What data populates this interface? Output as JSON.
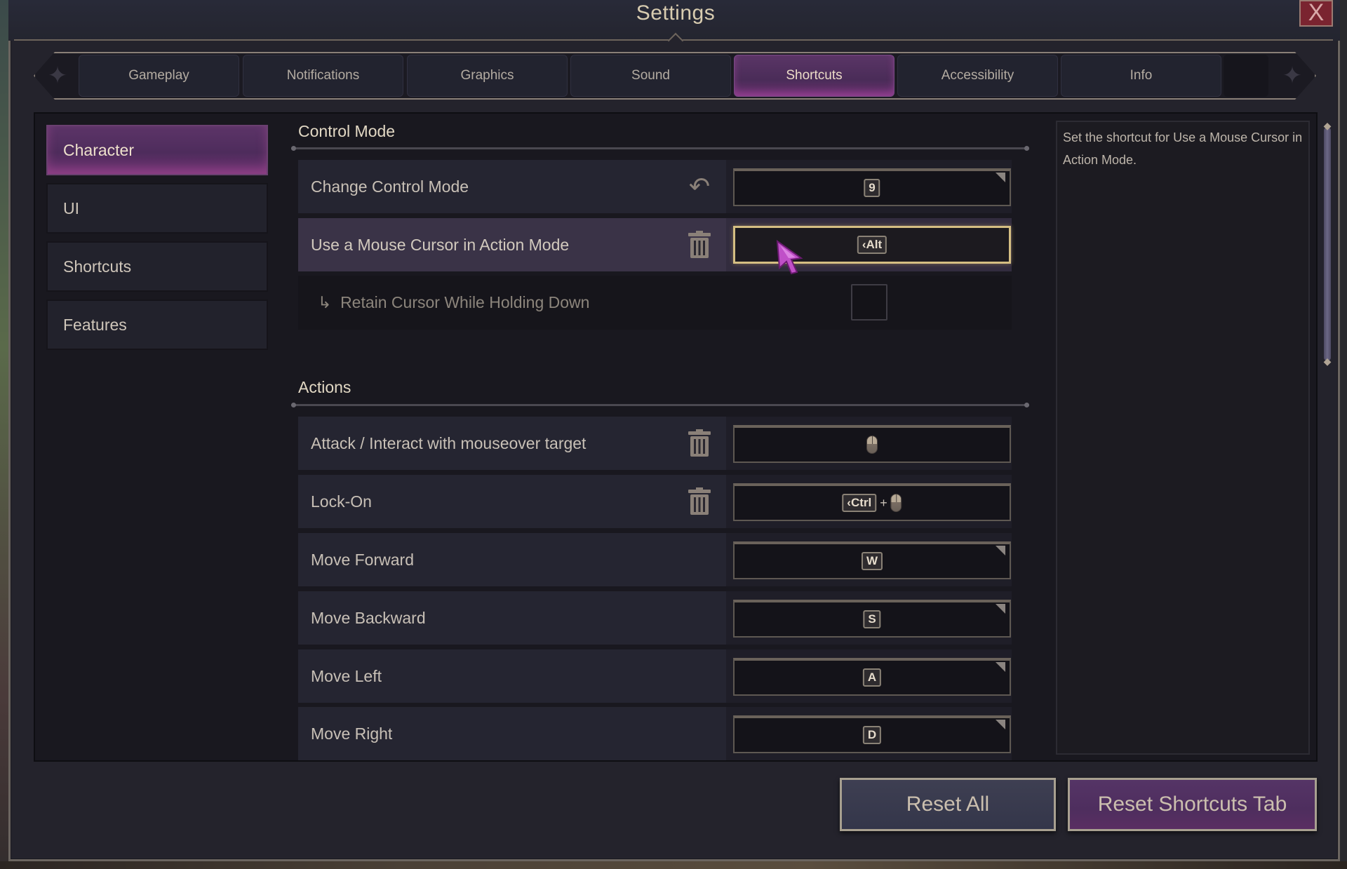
{
  "window": {
    "title": "Settings",
    "close_label": "X"
  },
  "tabs": [
    {
      "label": "Gameplay",
      "active": false
    },
    {
      "label": "Notifications",
      "active": false
    },
    {
      "label": "Graphics",
      "active": false
    },
    {
      "label": "Sound",
      "active": false
    },
    {
      "label": "Shortcuts",
      "active": true
    },
    {
      "label": "Accessibility",
      "active": false
    },
    {
      "label": "Info",
      "active": false
    }
  ],
  "tab_arrows": {
    "prev_icon": "ornate-left-arrow",
    "next_icon": "ornate-right-arrow"
  },
  "sidebar": {
    "items": [
      {
        "label": "Character",
        "active": true
      },
      {
        "label": "UI",
        "active": false
      },
      {
        "label": "Shortcuts",
        "active": false
      },
      {
        "label": "Features",
        "active": false
      }
    ]
  },
  "sections": {
    "control_mode": {
      "title": "Control Mode",
      "rows": [
        {
          "label": "Change Control Mode",
          "action_icon": "undo-icon",
          "binding": "9",
          "has_dropdown": true
        },
        {
          "label": "Use a Mouse Cursor in Action Mode",
          "action_icon": "trash-icon",
          "binding": "Alt",
          "selected": true,
          "focused": true
        }
      ],
      "sub_option": {
        "prefix": "↳",
        "label": "Retain Cursor While Holding Down",
        "checked": false
      }
    },
    "actions": {
      "title": "Actions",
      "rows": [
        {
          "label": "Attack / Interact with mouseover target",
          "action_icon": "trash-icon",
          "binding": "left-mouse-button"
        },
        {
          "label": "Lock-On",
          "action_icon": "trash-icon",
          "binding_modifier": "Ctrl",
          "binding_plus": "+",
          "binding": "left-mouse-button"
        },
        {
          "label": "Move Forward",
          "binding": "W",
          "has_dropdown": true
        },
        {
          "label": "Move Backward",
          "binding": "S",
          "has_dropdown": true
        },
        {
          "label": "Move Left",
          "binding": "A",
          "has_dropdown": true
        },
        {
          "label": "Move Right",
          "binding": "D",
          "has_dropdown": true
        }
      ]
    }
  },
  "description": {
    "text": "Set the shortcut for Use a Mouse Cursor in Action Mode."
  },
  "buttons": {
    "reset_all": "Reset All",
    "reset_tab": "Reset Shortcuts Tab"
  },
  "colors": {
    "accent_purple": "#5a3566",
    "focus_gold": "#d4be82",
    "close_red": "#7a2430"
  }
}
